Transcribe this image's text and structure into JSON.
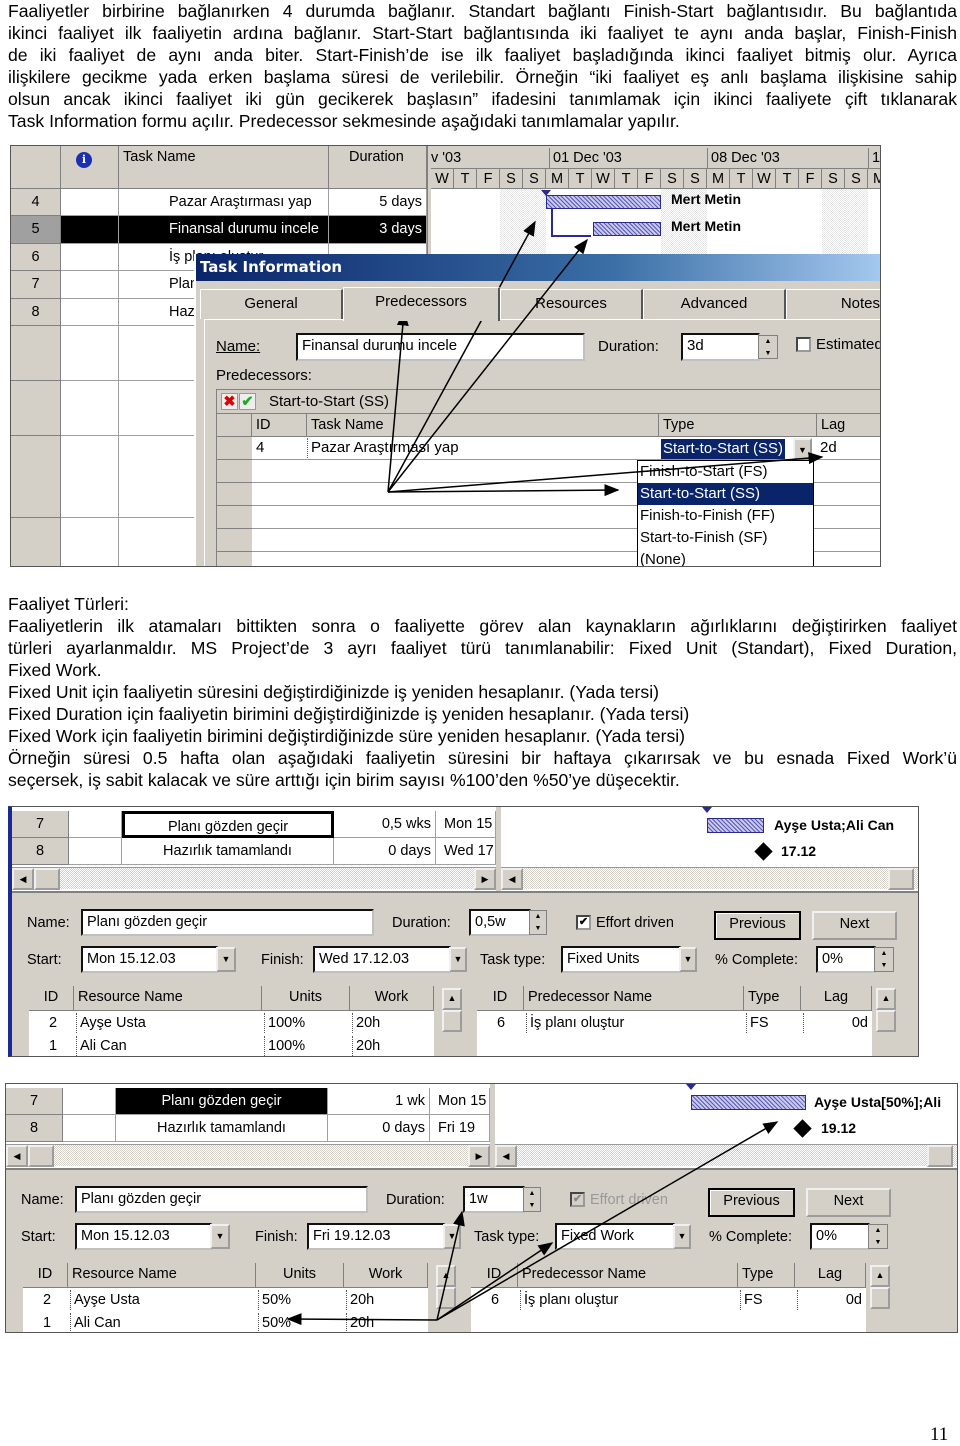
{
  "intro": {
    "lines": [
      "Faaliyetler birbirine bağlanırken 4 durumda bağlanır. Standart bağlantı Finish-Start bağlantısıdır. Bu bağlantıda",
      "ikinci faaliyet ilk faaliyetin ardına bağlanır. Start-Start bağlantısında iki faaliyet te aynı anda başlar, Finish-Finish",
      "de iki faaliyet de aynı anda biter. Start-Finish’de ise ilk faaliyet başladığında ikinci faaliyet bitmiş olur. Ayrıca",
      "ilişkilere gecikme yada erken başlama süresi de verilebilir. Örneğin “iki faaliyet eş anlı başlama ilişkisine sahip",
      "olsun ancak ikinci faaliyet iki gün gecikerek başlasın” ifadesini tanımlamak için ikinci faaliyete çift tıklanarak",
      "Task Information formu açılır. Predecessor sekmesinde aşağıdaki tanımlamalar yapılır."
    ]
  },
  "shot1": {
    "columns": {
      "task_name": "Task Name",
      "duration": "Duration"
    },
    "rows": [
      {
        "id": "4",
        "name": "Pazar Araştırması yap",
        "duration": "5 days"
      },
      {
        "id": "5",
        "name": "Finansal durumu incele",
        "duration": "3 days"
      },
      {
        "id": "6",
        "name": "İş planı oluştur",
        "duration": ""
      },
      {
        "id": "7",
        "name": "Planı gözden geçir",
        "duration": ""
      },
      {
        "id": "8",
        "name": "Hazırlık tamamlandı",
        "duration": ""
      }
    ],
    "timescale": {
      "weeks": [
        "v '03",
        "01 Dec '03",
        "08 Dec '03",
        "1"
      ],
      "days": [
        "W",
        "T",
        "F",
        "S",
        "S",
        "M",
        "T",
        "W",
        "T",
        "F",
        "S",
        "S",
        "M",
        "T",
        "W",
        "T",
        "F",
        "S",
        "S",
        "M"
      ]
    },
    "bar_labels": [
      "Mert Metin",
      "Mert Metin"
    ],
    "bar_color": "#2a2a90",
    "dialog": {
      "title": "Task Information",
      "tabs": [
        "General",
        "Predecessors",
        "Resources",
        "Advanced",
        "Notes"
      ],
      "name_label": "Name:",
      "name_value": "Finansal durumu incele",
      "duration_label": "Duration:",
      "duration_value": "3d",
      "estimated_label": "Estimated",
      "predecessors_label": "Predecessors:",
      "edit_value": "Start-to-Start (SS)",
      "grid_headers": {
        "id": "ID",
        "task_name": "Task Name",
        "type": "Type",
        "lag": "Lag"
      },
      "row": {
        "id": "4",
        "task_name": "Pazar Araştırması yap",
        "type": "Start-to-Start (SS)",
        "lag": "2d"
      },
      "type_options": [
        "Finish-to-Start (FS)",
        "Start-to-Start (SS)",
        "Finish-to-Finish (FF)",
        "Start-to-Finish (SF)",
        "(None)"
      ],
      "selected_option": "Start-to-Start (SS)",
      "title_color": "#0a246a"
    }
  },
  "section2": {
    "lines": [
      "Faaliyet Türleri:",
      "Faaliyetlerin ilk atamaları bittikten sonra o faaliyette görev alan kaynakların ağırlıklarını değiştirirken faaliyet",
      "türleri ayarlanmaldır. MS Project’de 3 ayrı faaliyet türü tanımlanabilir: Fixed Unit (Standart), Fixed Duration,",
      "Fixed Work.",
      "Fixed Unit için faaliyetin süresini değiştirdiğinizde iş yeniden hesaplanır. (Yada tersi)",
      "Fixed Duration için faaliyetin birimini değiştirdiğinizde iş yeniden hesaplanır. (Yada tersi)",
      "Fixed Work için faaliyetin birimini değiştirdiğinizde süre yeniden hesaplanır. (Yada tersi)",
      "Örneğin süresi 0.5 hafta olan aşağıdaki faaliyetin süresini bir haftaya çıkarırsak ve bu esnada Fixed Work’ü",
      "seçersek, iş sabit kalacak ve süre arttığı için birim sayısı %100’den %50’ye düşecektir."
    ]
  },
  "labels": {
    "name": "Name:",
    "duration": "Duration:",
    "effort": "Effort driven",
    "previous": "Previous",
    "next": "Next",
    "start": "Start:",
    "finish": "Finish:",
    "task_type": "Task type:",
    "complete": "% Complete:",
    "res_headers": {
      "id": "ID",
      "name": "Resource Name",
      "units": "Units",
      "work": "Work"
    },
    "pred_headers": {
      "id": "ID",
      "name": "Predecessor Name",
      "type": "Type",
      "lag": "Lag"
    }
  },
  "shot2": {
    "rows": [
      {
        "id": "7",
        "name": "Planı gözden geçir",
        "duration": "0,5 wks",
        "start": "Mon 15"
      },
      {
        "id": "8",
        "name": "Hazırlık tamamlandı",
        "duration": "0 days",
        "start": "Wed 17"
      }
    ],
    "bar_label": "Ayşe Usta;Ali Can",
    "milestone_label": "17.12",
    "name": "Planı gözden geçir",
    "duration": "0,5w",
    "effort_driven": true,
    "start": "Mon 15.12.03",
    "finish": "Wed 17.12.03",
    "task_type": "Fixed Units",
    "complete": "0%",
    "resources": [
      {
        "id": "2",
        "name": "Ayşe Usta",
        "units": "100%",
        "work": "20h"
      },
      {
        "id": "1",
        "name": "Ali Can",
        "units": "100%",
        "work": "20h"
      }
    ],
    "predecessors": [
      {
        "id": "6",
        "name": "İş planı oluştur",
        "type": "FS",
        "lag": "0d"
      }
    ]
  },
  "shot3": {
    "rows": [
      {
        "id": "7",
        "name": "Planı gözden geçir",
        "duration": "1 wk",
        "start": "Mon 15"
      },
      {
        "id": "8",
        "name": "Hazırlık tamamlandı",
        "duration": "0 days",
        "start": "Fri 19"
      }
    ],
    "bar_label": "Ayşe Usta[50%];Ali",
    "milestone_label": "19.12",
    "name": "Planı gözden geçir",
    "duration": "1w",
    "effort_driven": true,
    "start": "Mon 15.12.03",
    "finish": "Fri 19.12.03",
    "task_type": "Fixed Work",
    "complete": "0%",
    "resources": [
      {
        "id": "2",
        "name": "Ayşe Usta",
        "units": "50%",
        "work": "20h"
      },
      {
        "id": "1",
        "name": "Ali Can",
        "units": "50%",
        "work": "20h"
      }
    ],
    "predecessors": [
      {
        "id": "6",
        "name": "İş planı oluştur",
        "type": "FS",
        "lag": "0d"
      }
    ]
  },
  "page_number": "11"
}
